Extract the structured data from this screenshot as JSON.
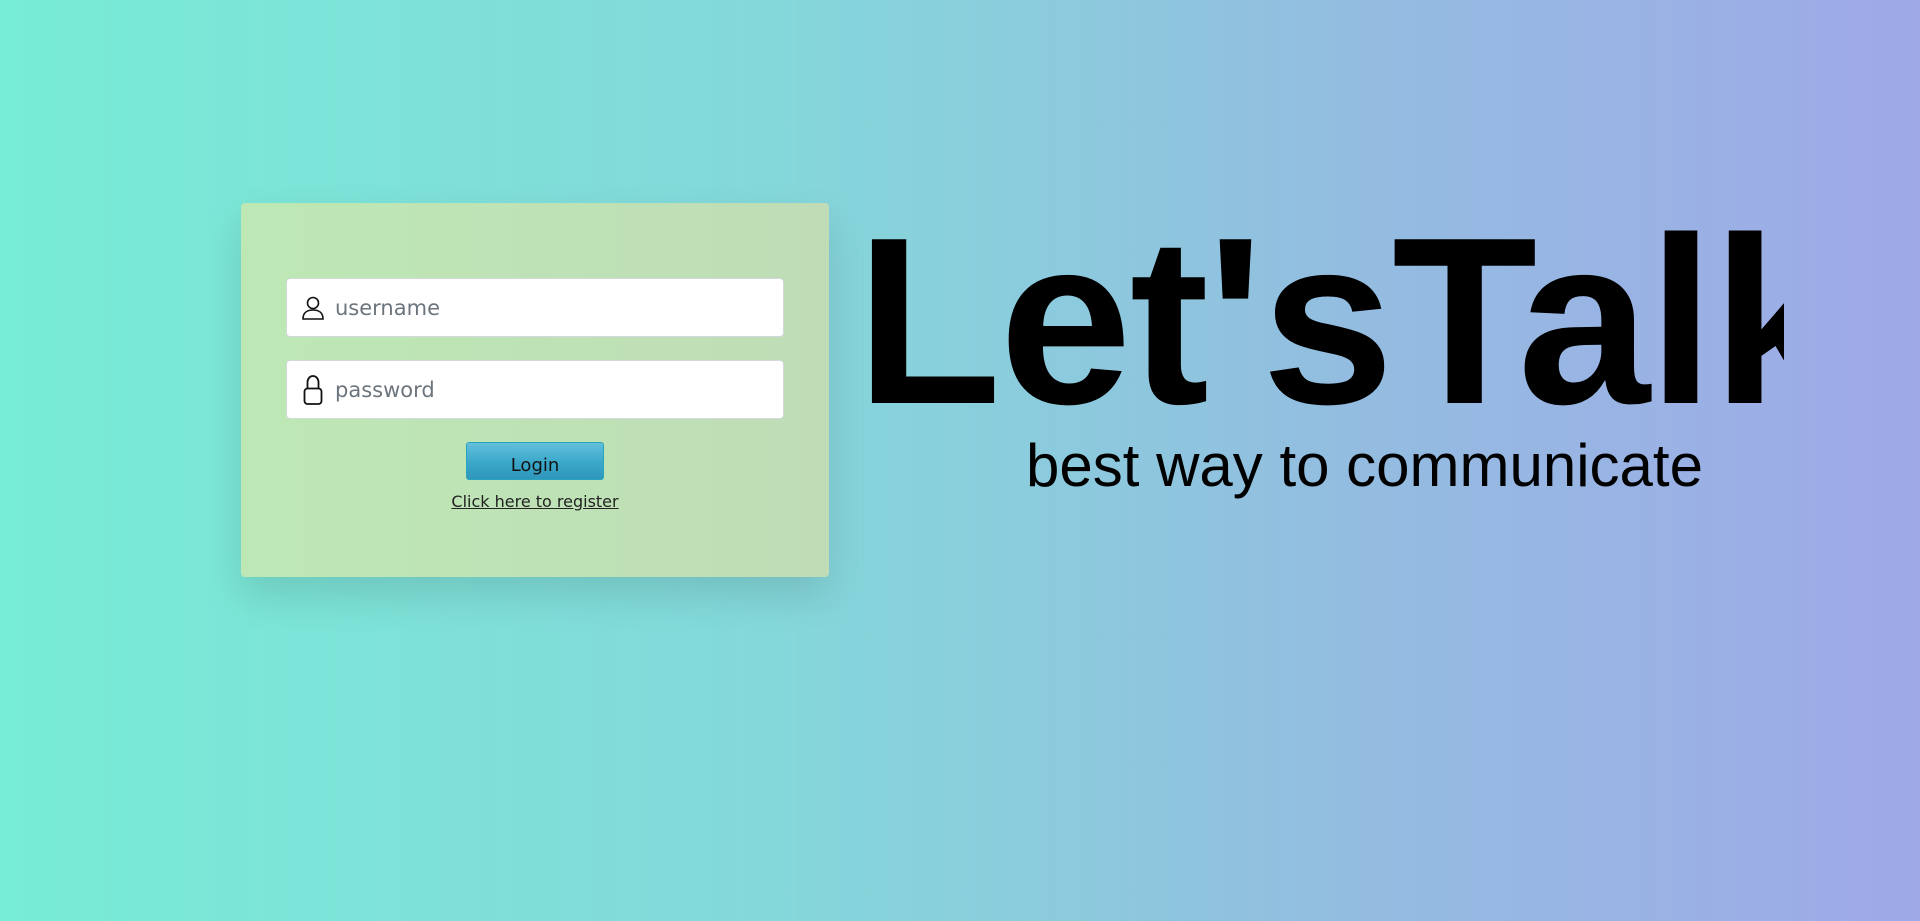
{
  "login_form": {
    "username": {
      "placeholder": "username",
      "value": "",
      "icon": "user-icon"
    },
    "password": {
      "placeholder": "password",
      "value": "",
      "icon": "lock-icon"
    },
    "login_label": "Login",
    "register_label": "Click here to register"
  },
  "brand": {
    "title": "Let'sTalk",
    "tagline": "best way to communicate"
  },
  "colors": {
    "background_start": "#77ecd6",
    "background_end": "#9fa9e8",
    "card": "#bfe3b6",
    "button": "#3aa7c9"
  }
}
